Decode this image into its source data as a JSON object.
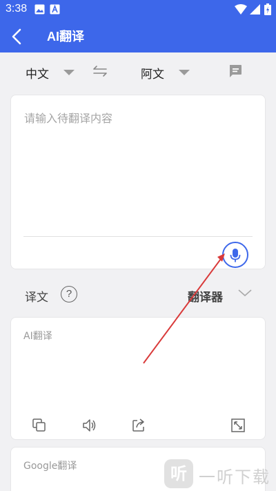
{
  "status_bar": {
    "time": "3:38"
  },
  "app_bar": {
    "title": "AI翻译"
  },
  "lang_bar": {
    "source_lang": "中文",
    "target_lang": "阿文"
  },
  "input": {
    "placeholder": "请输入待翻译内容"
  },
  "result_bar": {
    "label": "译文",
    "help_symbol": "?",
    "engine_label": "翻译器"
  },
  "ai_card": {
    "header": "AI翻译"
  },
  "google_card": {
    "header": "Google翻译"
  },
  "watermark": {
    "badge": "听",
    "text": "一听下载"
  },
  "colors": {
    "accent": "#3d67ea",
    "annotation_arrow": "#d93a3a",
    "background": "#f1f1f3"
  }
}
